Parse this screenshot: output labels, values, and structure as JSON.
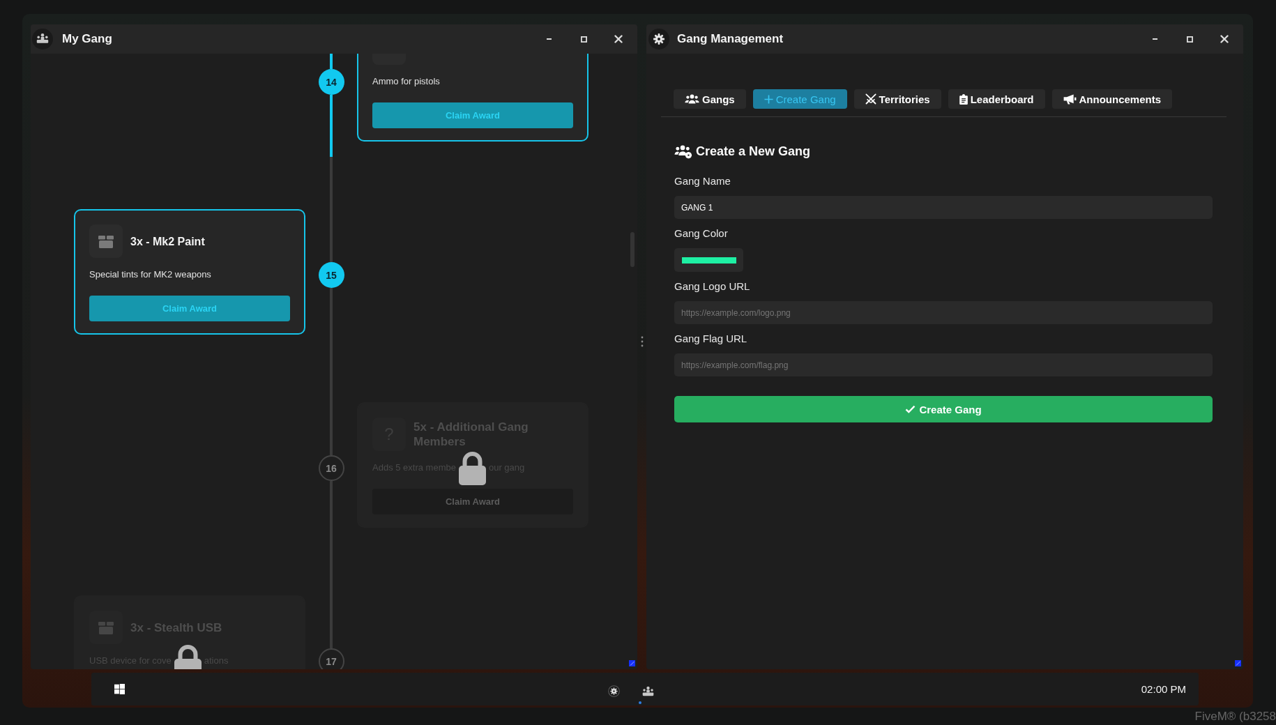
{
  "my_gang_window": {
    "title": "My Gang",
    "milestones": [
      {
        "number": "14",
        "locked": false,
        "description": [
          "Ammo for pistols"
        ],
        "button": "Claim Award"
      },
      {
        "number": "15",
        "locked": false,
        "line": {
          "level": 0.37
        },
        "title": "3x - Mk2 Paint",
        "description": [
          "Special tints for MK2 weapons"
        ],
        "button": "Claim Award"
      },
      {
        "number": "16",
        "locked": true,
        "glyph": "?",
        "title": "5x - Additional Gang Members",
        "description": [
          "Adds 5 extra membe",
          "our gang"
        ],
        "button": "Claim Award"
      },
      {
        "number": "17",
        "locked": true,
        "title": "3x - Stealth USB",
        "description": [
          "USB device for cove",
          "ations"
        ]
      }
    ]
  },
  "gang_management_window": {
    "title": "Gang Management",
    "tabs": [
      {
        "label": "Gangs",
        "selected": false
      },
      {
        "label": "Create Gang",
        "selected": true
      },
      {
        "label": "Territories",
        "selected": false
      },
      {
        "label": "Leaderboard",
        "selected": false
      },
      {
        "label": "Announcements",
        "selected": false
      }
    ],
    "heading": "Create a New Gang",
    "fields": [
      {
        "kind": "text",
        "label": "Gang Name",
        "value": "GANG 1"
      },
      {
        "kind": "color",
        "label": "Gang Color",
        "color": "#1ef0a4"
      },
      {
        "kind": "text",
        "label": "Gang Logo URL",
        "placeholder": "https://example.com/logo.png"
      },
      {
        "kind": "text",
        "label": "Gang Flag URL",
        "placeholder": "https://example.com/flag.png"
      }
    ],
    "submit_button": "Create Gang"
  },
  "taskbar": {
    "apps": [
      {
        "active": false
      },
      {
        "active": true
      }
    ],
    "clock": "02:00 PM"
  },
  "overlay_text": "FiveM® (b3258"
}
